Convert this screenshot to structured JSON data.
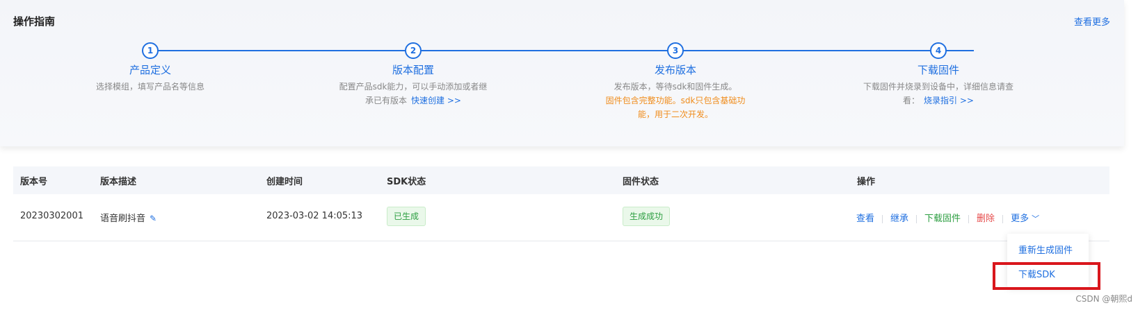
{
  "guide": {
    "title": "操作指南",
    "view_more": "查看更多",
    "steps": [
      {
        "num": "1",
        "title": "产品定义",
        "desc1": "选择模组，填写产品名等信息",
        "desc2": "",
        "link": "",
        "orange1": "",
        "orange2": ""
      },
      {
        "num": "2",
        "title": "版本配置",
        "desc1": "配置产品sdk能力，可以手动添加或者继",
        "desc2": "承已有版本",
        "link": "快速创建 >>",
        "orange1": "",
        "orange2": ""
      },
      {
        "num": "3",
        "title": "发布版本",
        "desc1": "发布版本，等待sdk和固件生成。",
        "desc2": "",
        "link": "",
        "orange1": "固件包含完整功能。sdk只包含基础功",
        "orange2": "能，用于二次开发。"
      },
      {
        "num": "4",
        "title": "下载固件",
        "desc1": "下载固件并烧录到设备中，详细信息请查",
        "desc2": "看：",
        "link": "烧录指引 >>",
        "orange1": "",
        "orange2": ""
      }
    ]
  },
  "table": {
    "headers": [
      "版本号",
      "版本描述",
      "创建时间",
      "SDK状态",
      "固件状态",
      "操作"
    ],
    "rows": [
      {
        "version": "20230302001",
        "description": "语音刷抖音",
        "created": "2023-03-02 14:05:13",
        "sdk_status": "已生成",
        "firmware_status": "生成成功",
        "actions": {
          "view": "查看",
          "inherit": "继承",
          "download": "下载固件",
          "delete": "删除",
          "more": "更多"
        }
      }
    ]
  },
  "dropdown": {
    "items": [
      "重新生成固件",
      "下载SDK"
    ]
  },
  "watermark": "CSDN @朝熙d"
}
